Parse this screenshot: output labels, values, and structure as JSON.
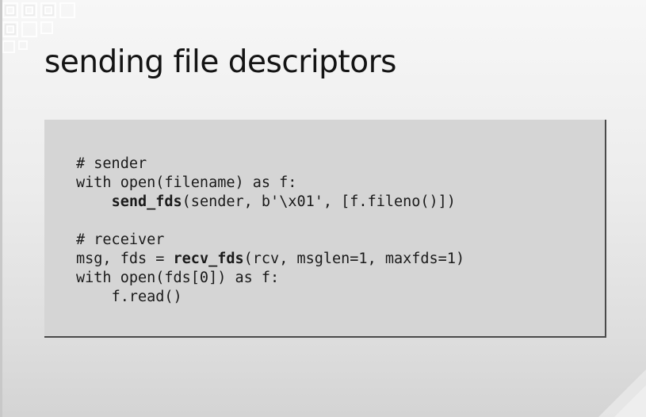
{
  "slide": {
    "title": "sending file descriptors"
  },
  "code": {
    "lines": [
      {
        "indent": "",
        "before": "# sender",
        "bold": "",
        "after": ""
      },
      {
        "indent": "",
        "before": "with open(filename) as f:",
        "bold": "",
        "after": ""
      },
      {
        "indent": "    ",
        "before": "",
        "bold": "send_fds",
        "after": "(sender, b'\\x01', [f.fileno()])"
      },
      {
        "indent": "",
        "before": "",
        "bold": "",
        "after": ""
      },
      {
        "indent": "",
        "before": "# receiver",
        "bold": "",
        "after": ""
      },
      {
        "indent": "",
        "before": "msg, fds = ",
        "bold": "recv_fds",
        "after": "(rcv, msglen=1, maxfds=1)"
      },
      {
        "indent": "",
        "before": "with open(fds[0]) as f:",
        "bold": "",
        "after": ""
      },
      {
        "indent": "    ",
        "before": "f.read()",
        "bold": "",
        "after": ""
      }
    ]
  },
  "colors": {
    "title": "#141414",
    "code_background": "#d5d5d5",
    "code_shadow": "#4a4a4a"
  },
  "decorations": {
    "corner_pattern": "square-maze-pattern"
  }
}
